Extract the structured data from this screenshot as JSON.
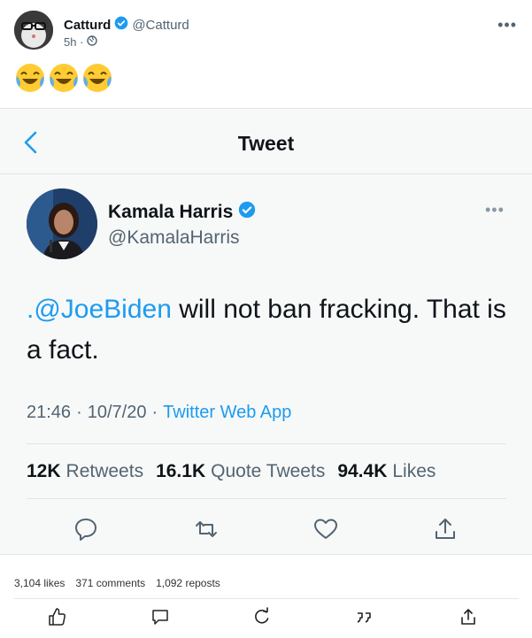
{
  "post": {
    "author_name": "Catturd",
    "author_handle": "@Catturd",
    "time": "5h ·",
    "emoji_reactions": [
      "😂",
      "😂",
      "😂"
    ]
  },
  "embedded_tweet": {
    "header_title": "Tweet",
    "author_name": "Kamala Harris",
    "author_handle": "@KamalaHarris",
    "text_mention": ".@JoeBiden",
    "text_body": " will not ban fracking. That is a fact.",
    "time": "21:46",
    "date": "10/7/20",
    "app": "Twitter Web App",
    "retweets_count": "12K",
    "retweets_label": "Retweets",
    "quote_count": "16.1K",
    "quote_label": "Quote Tweets",
    "likes_count": "94.4K",
    "likes_label": "Likes",
    "accent_color": "#1d9bf0"
  },
  "footer": {
    "likes": "3,104 likes",
    "comments": "371 comments",
    "reposts": "1,092 reposts"
  }
}
